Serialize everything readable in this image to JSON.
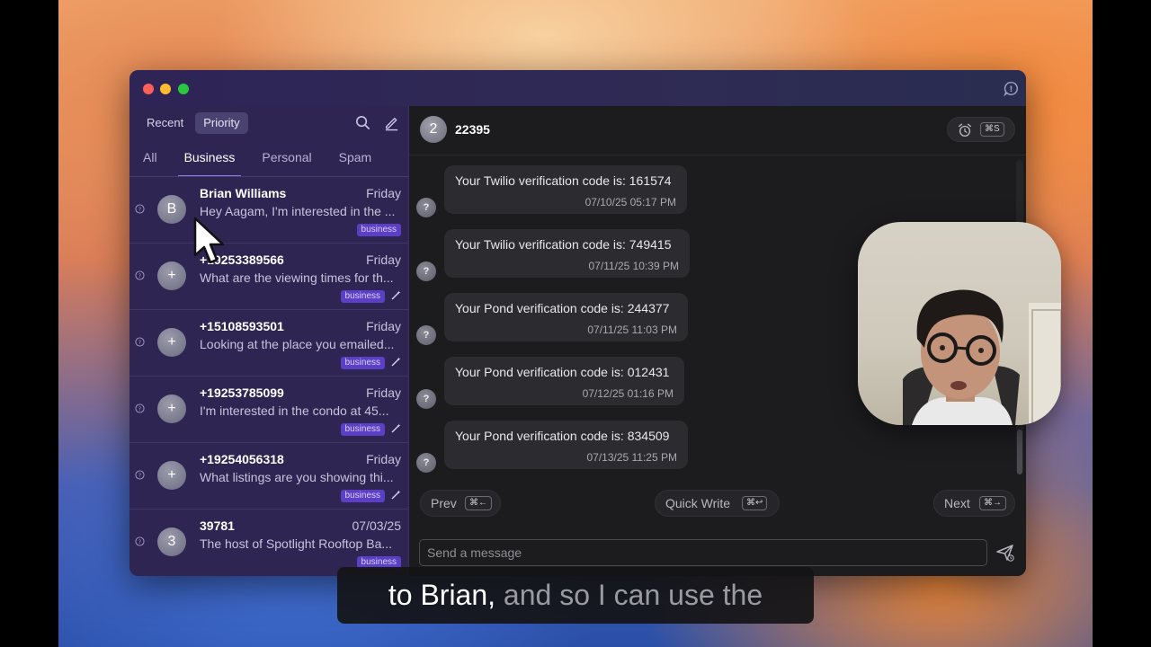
{
  "sidebar": {
    "segments": [
      {
        "label": "Recent",
        "active": false
      },
      {
        "label": "Priority",
        "active": true
      }
    ],
    "tabs": [
      {
        "label": "All",
        "active": false
      },
      {
        "label": "Business",
        "active": true
      },
      {
        "label": "Personal",
        "active": false
      },
      {
        "label": "Spam",
        "active": false
      }
    ],
    "conversations": [
      {
        "avatar": "B",
        "name": "Brian Williams",
        "date": "Friday",
        "preview": "Hey Aagam, I'm interested in the ...",
        "badge": "business",
        "wand": false
      },
      {
        "avatar": "+",
        "name": "+19253389566",
        "date": "Friday",
        "preview": "What are the viewing times for th...",
        "badge": "business",
        "wand": true
      },
      {
        "avatar": "+",
        "name": "+15108593501",
        "date": "Friday",
        "preview": "Looking at the place you emailed...",
        "badge": "business",
        "wand": true
      },
      {
        "avatar": "+",
        "name": "+19253785099",
        "date": "Friday",
        "preview": "I'm interested in the condo at 45...",
        "badge": "business",
        "wand": true
      },
      {
        "avatar": "+",
        "name": "+19254056318",
        "date": "Friday",
        "preview": "What listings are you showing thi...",
        "badge": "business",
        "wand": true
      },
      {
        "avatar": "3",
        "name": "39781",
        "date": "07/03/25",
        "preview": "The host of Spotlight Rooftop Ba...",
        "badge": "business",
        "wand": false
      }
    ]
  },
  "chat": {
    "avatar": "2",
    "title": "22395",
    "snooze_shortcut": "⌘S",
    "messages": [
      {
        "sender": "?",
        "text": "Your Twilio verification code is: 161574",
        "time": "07/10/25 05:17 PM"
      },
      {
        "sender": "?",
        "text": "Your Twilio verification code is: 749415",
        "time": "07/11/25 10:39 PM"
      },
      {
        "sender": "?",
        "text": "Your Pond verification code is: 244377",
        "time": "07/11/25 11:03 PM"
      },
      {
        "sender": "?",
        "text": "Your Pond verification code is: 012431",
        "time": "07/12/25 01:16 PM"
      },
      {
        "sender": "?",
        "text": "Your Pond verification code is: 834509",
        "time": "07/13/25 11:25 PM"
      }
    ],
    "prev": {
      "label": "Prev",
      "shortcut": "⌘←"
    },
    "quick_write": {
      "label": "Quick Write",
      "shortcut": "⌘↩"
    },
    "next": {
      "label": "Next",
      "shortcut": "⌘→"
    },
    "composer_placeholder": "Send a message"
  },
  "caption": {
    "highlighted": "to Brian,",
    "rest": " and so I can use the"
  }
}
